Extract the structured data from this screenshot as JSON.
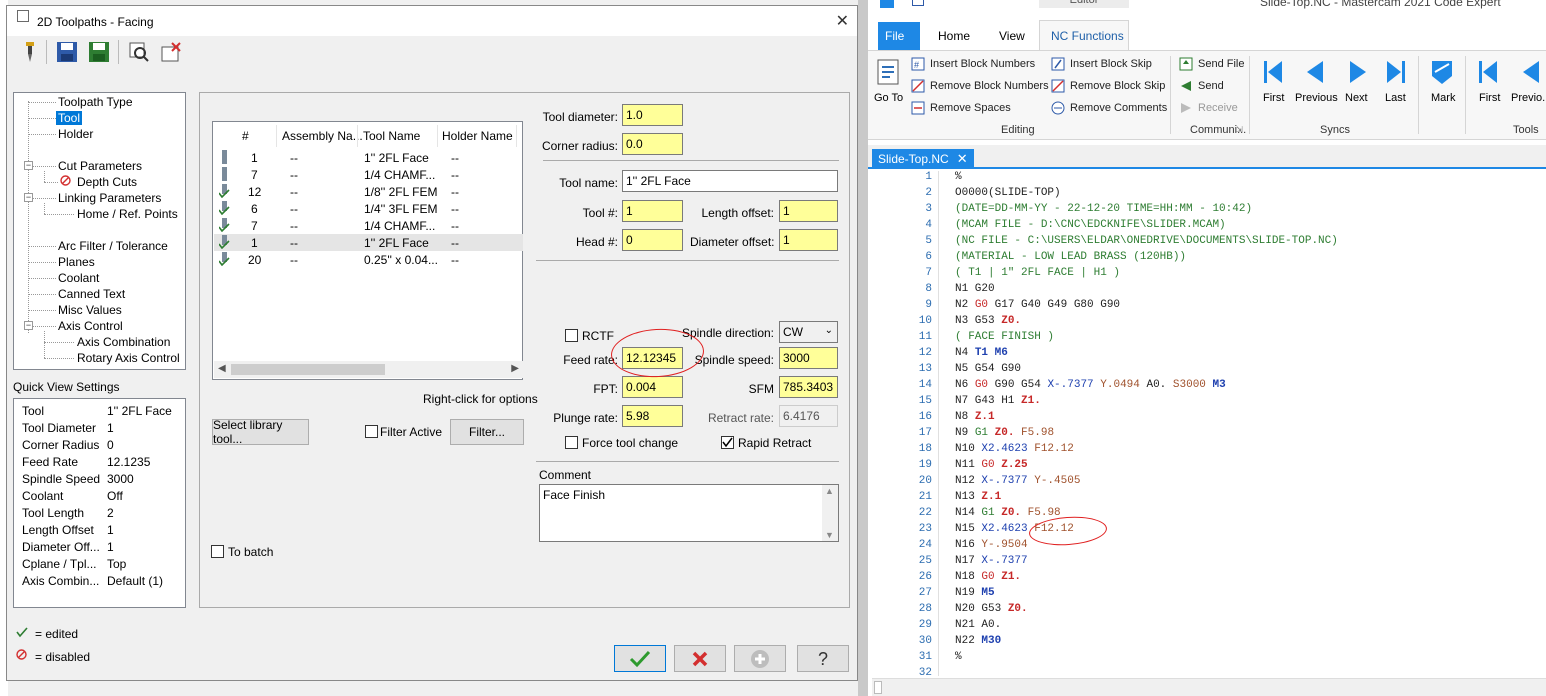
{
  "dialog": {
    "title": "2D Toolpaths - Facing",
    "close_glyph": "✕",
    "tree": [
      {
        "label": "Toolpath Type"
      },
      {
        "label": "Tool"
      },
      {
        "label": "Holder"
      },
      {
        "label": "Cut Parameters"
      },
      {
        "label": "Depth Cuts"
      },
      {
        "label": "Linking Parameters"
      },
      {
        "label": "Home / Ref. Points"
      },
      {
        "label": "Arc Filter / Tolerance"
      },
      {
        "label": "Planes"
      },
      {
        "label": "Coolant"
      },
      {
        "label": "Canned Text"
      },
      {
        "label": "Misc Values"
      },
      {
        "label": "Axis Control"
      },
      {
        "label": "Axis Combination"
      },
      {
        "label": "Rotary Axis Control"
      }
    ],
    "quick_view": {
      "label": "Quick View Settings",
      "rows": [
        {
          "k": "Tool",
          "v": "1'' 2FL Face"
        },
        {
          "k": "Tool Diameter",
          "v": "1"
        },
        {
          "k": "Corner Radius",
          "v": "0"
        },
        {
          "k": "Feed Rate",
          "v": "12.1235"
        },
        {
          "k": "Spindle Speed",
          "v": "3000"
        },
        {
          "k": "Coolant",
          "v": "Off"
        },
        {
          "k": "Tool Length",
          "v": "2"
        },
        {
          "k": "Length Offset",
          "v": "1"
        },
        {
          "k": "Diameter Off...",
          "v": "1"
        },
        {
          "k": "Cplane / Tpl...",
          "v": "Top"
        },
        {
          "k": "Axis Combin...",
          "v": "Default (1)"
        }
      ]
    },
    "legend": {
      "edited": "= edited",
      "disabled": "= disabled"
    },
    "tool_list": {
      "headers": [
        "#",
        "Assembly Na...",
        "Tool Name",
        "Holder Name"
      ],
      "rows": [
        {
          "num": "1",
          "assembly": "--",
          "name": "1'' 2FL Face",
          "holder": "--"
        },
        {
          "num": "7",
          "assembly": "--",
          "name": "1/4 CHAMF...",
          "holder": "--"
        },
        {
          "num": "12",
          "assembly": "--",
          "name": "1/8'' 2FL FEM",
          "holder": "--"
        },
        {
          "num": "6",
          "assembly": "--",
          "name": "1/4'' 3FL FEM",
          "holder": "--"
        },
        {
          "num": "7",
          "assembly": "--",
          "name": "1/4 CHAMF...",
          "holder": "--"
        },
        {
          "num": "1",
          "assembly": "--",
          "name": "1'' 2FL Face",
          "holder": "--"
        },
        {
          "num": "20",
          "assembly": "--",
          "name": "0.25'' x 0.04...",
          "holder": "--"
        }
      ]
    },
    "right_click_hint": "Right-click for options",
    "select_library_tool": "Select library tool...",
    "filter_active": "Filter Active",
    "filter_button": "Filter...",
    "to_batch": "To batch",
    "fields": {
      "tool_diameter_label": "Tool diameter:",
      "tool_diameter": "1.0",
      "corner_radius_label": "Corner radius:",
      "corner_radius": "0.0",
      "tool_name_label": "Tool name:",
      "tool_name": "1'' 2FL Face",
      "tool_num_label": "Tool #:",
      "tool_num": "1",
      "length_offset_label": "Length offset:",
      "length_offset": "1",
      "head_num_label": "Head #:",
      "head_num": "0",
      "diameter_offset_label": "Diameter offset:",
      "diameter_offset": "1",
      "rctf_label": "RCTF",
      "spindle_direction_label": "Spindle direction:",
      "spindle_direction": "CW",
      "feed_rate_label": "Feed rate:",
      "feed_rate": "12.12345",
      "spindle_speed_label": "Spindle speed:",
      "spindle_speed": "3000",
      "fpt_label": "FPT:",
      "fpt": "0.004",
      "sfm_label": "SFM",
      "sfm": "785.3403",
      "plunge_rate_label": "Plunge rate:",
      "plunge_rate": "5.98",
      "retract_rate_label": "Retract rate:",
      "retract_rate": "6.4176",
      "force_tool_change_label": "Force tool change",
      "rapid_retract_label": "Rapid Retract",
      "comment_label": "Comment",
      "comment": "Face Finish"
    }
  },
  "editor": {
    "window_title": "Slide-Top.NC - Mastercam 2021 Code Expert",
    "context_tab": "Editor",
    "tabs": [
      "File",
      "Home",
      "View",
      "NC Functions"
    ],
    "goto_label": "Go To",
    "editing": {
      "items": [
        "Insert Block Numbers",
        "Remove Block Numbers",
        "Remove Spaces",
        "Insert Block Skip",
        "Remove Block Skip",
        "Remove Comments"
      ],
      "group": "Editing"
    },
    "comm": {
      "items": [
        "Send File",
        "Send",
        "Receive"
      ],
      "group": "Communi..."
    },
    "syncs": {
      "items": [
        "First",
        "Previous",
        "Next",
        "Last"
      ],
      "group": "Syncs"
    },
    "tools": {
      "items": [
        "Mark",
        "First",
        "Previo..."
      ],
      "group": "Tools"
    },
    "doc_tab": "Slide-Top.NC",
    "code": [
      "%",
      "O0000(SLIDE-TOP)",
      "(DATE=DD-MM-YY - 22-12-20 TIME=HH:MM - 10:42)",
      "(MCAM FILE - D:\\CNC\\EDCKNIFE\\SLIDER.MCAM)",
      "(NC FILE - C:\\USERS\\ELDAR\\ONEDRIVE\\DOCUMENTS\\SLIDE-TOP.NC)",
      "(MATERIAL - LOW LEAD BRASS (120HB))",
      "( T1 | 1\" 2FL FACE | H1 )",
      "N1 G20",
      "N2 G0 G17 G40 G49 G80 G90",
      "N3 G53 Z0.",
      "( FACE FINISH )",
      "N4 T1 M6",
      "N5 G54 G90",
      "N6 G0 G90 G54 X-.7377 Y.0494 A0. S3000 M3",
      "N7 G43 H1 Z1.",
      "N8 Z.1",
      "N9 G1 Z0. F5.98",
      "N10 X2.4623 F12.12",
      "N11 G0 Z.25",
      "N12 X-.7377 Y-.4505",
      "N13 Z.1",
      "N14 G1 Z0. F5.98",
      "N15 X2.4623 F12.12",
      "N16 Y-.9504",
      "N17 X-.7377",
      "N18 G0 Z1.",
      "N19 M5",
      "N20 G53 Z0.",
      "N21 A0.",
      "N22 M30",
      "%",
      ""
    ]
  }
}
